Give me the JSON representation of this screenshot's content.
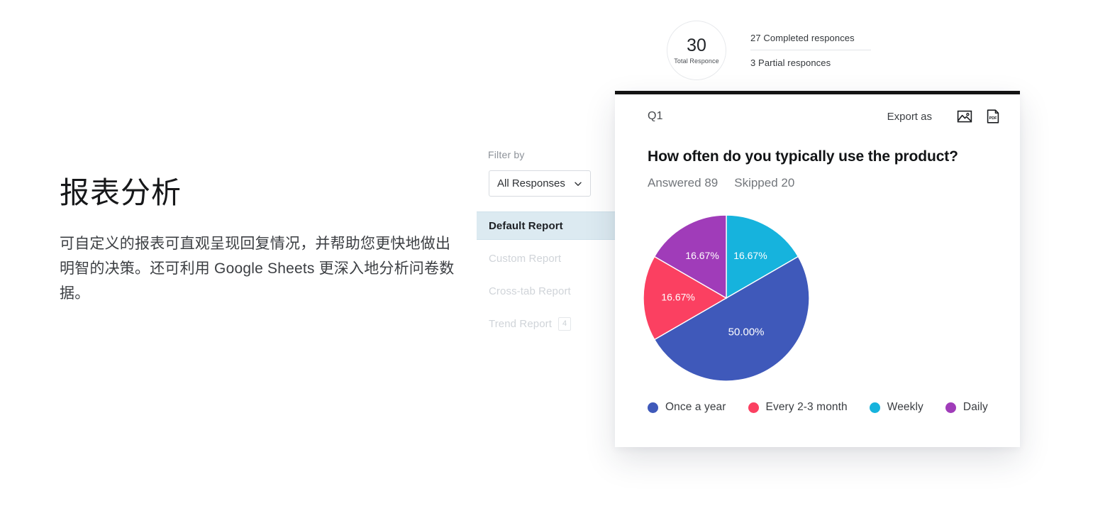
{
  "marketing": {
    "title": "报表分析",
    "body": "可自定义的报表可直观呈现回复情况，并帮助您更快地做出明智的决策。还可利用 Google Sheets 更深入地分析问卷数据。"
  },
  "panel": {
    "filter_label": "Filter by",
    "filter_value": "All Responses",
    "filter_chevron_icon": "chevron-down-icon",
    "reports": [
      {
        "label": "Default Report",
        "active": true,
        "badge": ""
      },
      {
        "label": "Custom Report",
        "active": false,
        "badge": ""
      },
      {
        "label": "Cross-tab Report",
        "active": false,
        "badge": ""
      },
      {
        "label": "Trend Report",
        "active": false,
        "badge": "4"
      }
    ]
  },
  "summary": {
    "total_value": "30",
    "total_caption": "Total Responce",
    "completed": "27 Completed responces",
    "partial": "3 Partial responces"
  },
  "card": {
    "question_id": "Q1",
    "export_label": "Export as",
    "export_image_icon": "image-export-icon",
    "export_pdf_icon": "pdf-export-icon",
    "question_title": "How often do you typically use the product?",
    "answered": "Answered 89",
    "skipped": "Skipped 20"
  },
  "chart_data": {
    "type": "pie",
    "title": "How often do you typically use the product?",
    "legend_position": "bottom",
    "categories": [
      "Once a year",
      "Every 2-3 month",
      "Weekly",
      "Daily"
    ],
    "values": [
      50.0,
      16.67,
      16.67,
      16.67
    ],
    "labels": [
      "50.00%",
      "16.67%",
      "16.67%",
      "16.67%"
    ],
    "colors": [
      "#3f59ba",
      "#fb4061",
      "#16b3dd",
      "#a03cb9"
    ],
    "slice_order_clockwise_from_top": [
      "Weekly",
      "Once a year",
      "Every 2-3 month",
      "Daily"
    ],
    "slices": [
      {
        "name": "Weekly",
        "value": 16.67,
        "label": "16.67%",
        "color": "#16b3dd",
        "start_deg": 0,
        "end_deg": 60
      },
      {
        "name": "Once a year",
        "value": 50.0,
        "label": "50.00%",
        "color": "#3f59ba",
        "start_deg": 60,
        "end_deg": 240
      },
      {
        "name": "Every 2-3 month",
        "value": 16.67,
        "label": "16.67%",
        "color": "#fb4061",
        "start_deg": 240,
        "end_deg": 300
      },
      {
        "name": "Daily",
        "value": 16.67,
        "label": "16.67%",
        "color": "#a03cb9",
        "start_deg": 300,
        "end_deg": 360
      }
    ]
  }
}
